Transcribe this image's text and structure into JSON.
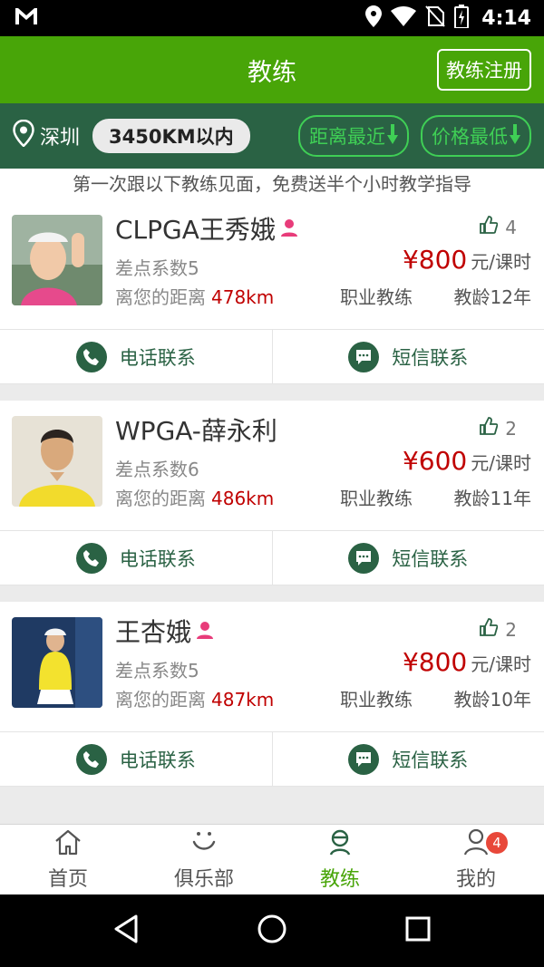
{
  "status": {
    "time": "4:14"
  },
  "header": {
    "title": "教练",
    "register_label": "教练注册"
  },
  "filter": {
    "city": "深圳",
    "range": "3450KM以内",
    "sort_distance": "距离最近",
    "sort_price": "价格最低"
  },
  "promo": "第一次跟以下教练见面，免费送半个小时教学指导",
  "coaches": [
    {
      "name": "CLPGA王秀娥",
      "handicap": "差点系数5",
      "distance_label": "离您的距离",
      "distance": "478km",
      "likes": "4",
      "price": "¥800",
      "unit": "元/课时",
      "job": "职业教练",
      "years": "教龄12年"
    },
    {
      "name": "WPGA-薛永利",
      "handicap": "差点系数6",
      "distance_label": "离您的距离",
      "distance": "486km",
      "likes": "2",
      "price": "¥600",
      "unit": "元/课时",
      "job": "职业教练",
      "years": "教龄11年"
    },
    {
      "name": "王杏娥",
      "handicap": "差点系数5",
      "distance_label": "离您的距离",
      "distance": "487km",
      "likes": "2",
      "price": "¥800",
      "unit": "元/课时",
      "job": "职业教练",
      "years": "教龄10年"
    }
  ],
  "actions": {
    "phone": "电话联系",
    "sms": "短信联系"
  },
  "tabs": [
    {
      "label": "首页"
    },
    {
      "label": "俱乐部"
    },
    {
      "label": "教练"
    },
    {
      "label": "我的",
      "badge": "4"
    }
  ],
  "colors": {
    "brand_green": "#48a508",
    "dark_green": "#2a6244",
    "price_red": "#c00000"
  }
}
